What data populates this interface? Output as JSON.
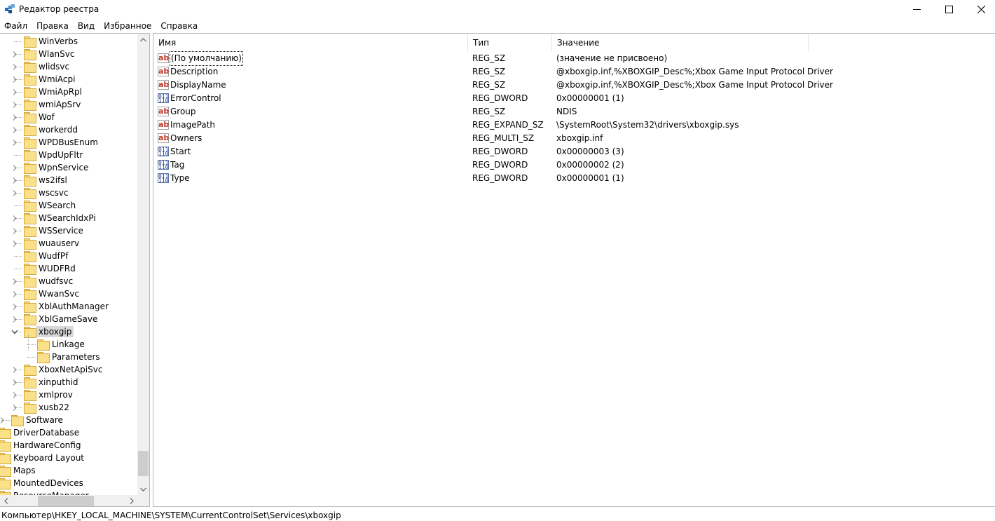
{
  "window": {
    "title": "Редактор реестра",
    "icon": "regedit-icon"
  },
  "menu": [
    "Файл",
    "Правка",
    "Вид",
    "Избранное",
    "Справка"
  ],
  "tree": {
    "items": [
      {
        "label": "WinVerbs",
        "expandable": false
      },
      {
        "label": "WlanSvc",
        "expandable": true
      },
      {
        "label": "wlidsvc",
        "expandable": true
      },
      {
        "label": "WmiAcpi",
        "expandable": true
      },
      {
        "label": "WmiApRpl",
        "expandable": true
      },
      {
        "label": "wmiApSrv",
        "expandable": true
      },
      {
        "label": "Wof",
        "expandable": true
      },
      {
        "label": "workerdd",
        "expandable": true
      },
      {
        "label": "WPDBusEnum",
        "expandable": true
      },
      {
        "label": "WpdUpFltr",
        "expandable": false
      },
      {
        "label": "WpnService",
        "expandable": true
      },
      {
        "label": "ws2ifsl",
        "expandable": true
      },
      {
        "label": "wscsvc",
        "expandable": true
      },
      {
        "label": "WSearch",
        "expandable": false
      },
      {
        "label": "WSearchIdxPi",
        "expandable": true
      },
      {
        "label": "WSService",
        "expandable": true
      },
      {
        "label": "wuauserv",
        "expandable": true
      },
      {
        "label": "WudfPf",
        "expandable": false
      },
      {
        "label": "WUDFRd",
        "expandable": false
      },
      {
        "label": "wudfsvc",
        "expandable": true
      },
      {
        "label": "WwanSvc",
        "expandable": true
      },
      {
        "label": "XblAuthManager",
        "expandable": true
      },
      {
        "label": "XblGameSave",
        "expandable": true
      },
      {
        "label": "xboxgip",
        "expandable": true,
        "expanded": true,
        "selected": true
      },
      {
        "label": "Linkage",
        "child": true
      },
      {
        "label": "Parameters",
        "child": true
      },
      {
        "label": "XboxNetApiSvc",
        "expandable": true
      },
      {
        "label": "xinputhid",
        "expandable": true
      },
      {
        "label": "xmlprov",
        "expandable": true
      },
      {
        "label": "xusb22",
        "expandable": true
      },
      {
        "label": "Software",
        "expandable": true,
        "level": 1
      },
      {
        "label": "DriverDatabase",
        "level": 0
      },
      {
        "label": "HardwareConfig",
        "level": 0
      },
      {
        "label": "Keyboard Layout",
        "level": 0
      },
      {
        "label": "Maps",
        "level": 0
      },
      {
        "label": "MountedDevices",
        "level": 0
      },
      {
        "label": "ResourceManager",
        "level": 0
      }
    ]
  },
  "list": {
    "columns": [
      "Имя",
      "Тип",
      "Значение"
    ],
    "rows": [
      {
        "name": "(По умолчанию)",
        "type": "REG_SZ",
        "value": "(значение не присвоено)",
        "icon": "string-value-icon"
      },
      {
        "name": "Description",
        "type": "REG_SZ",
        "value": "@xboxgip.inf,%XBOXGIP_Desc%;Xbox Game Input Protocol Driver",
        "icon": "string-value-icon"
      },
      {
        "name": "DisplayName",
        "type": "REG_SZ",
        "value": "@xboxgip.inf,%XBOXGIP_Desc%;Xbox Game Input Protocol Driver",
        "icon": "string-value-icon"
      },
      {
        "name": "ErrorControl",
        "type": "REG_DWORD",
        "value": "0x00000001 (1)",
        "icon": "binary-value-icon"
      },
      {
        "name": "Group",
        "type": "REG_SZ",
        "value": "NDIS",
        "icon": "string-value-icon"
      },
      {
        "name": "ImagePath",
        "type": "REG_EXPAND_SZ",
        "value": "\\SystemRoot\\System32\\drivers\\xboxgip.sys",
        "icon": "string-value-icon"
      },
      {
        "name": "Owners",
        "type": "REG_MULTI_SZ",
        "value": "xboxgip.inf",
        "icon": "string-value-icon"
      },
      {
        "name": "Start",
        "type": "REG_DWORD",
        "value": "0x00000003 (3)",
        "icon": "binary-value-icon"
      },
      {
        "name": "Tag",
        "type": "REG_DWORD",
        "value": "0x00000002 (2)",
        "icon": "binary-value-icon"
      },
      {
        "name": "Type",
        "type": "REG_DWORD",
        "value": "0x00000001 (1)",
        "icon": "binary-value-icon"
      }
    ]
  },
  "status": {
    "path": "Компьютер\\HKEY_LOCAL_MACHINE\\SYSTEM\\CurrentControlSet\\Services\\xboxgip"
  }
}
